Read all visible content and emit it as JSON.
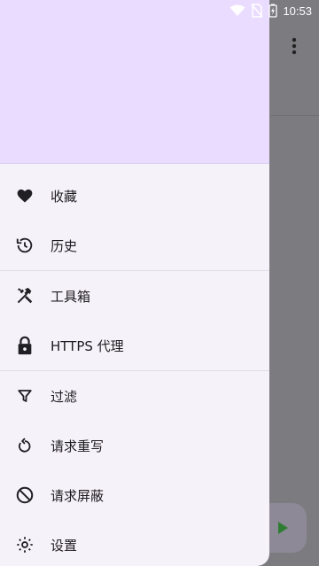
{
  "status_bar": {
    "time": "10:53",
    "icons": [
      "wifi-icon",
      "no-sim-icon",
      "battery-charging-icon"
    ]
  },
  "background": {
    "more_icon": "more-vert-icon",
    "fab_icon": "play-icon"
  },
  "drawer": {
    "groups": [
      [
        {
          "id": "favorites",
          "icon": "heart-icon",
          "label": "收藏"
        },
        {
          "id": "history",
          "icon": "history-icon",
          "label": "历史"
        }
      ],
      [
        {
          "id": "toolbox",
          "icon": "tools-icon",
          "label": "工具箱"
        },
        {
          "id": "https-proxy",
          "icon": "lock-icon",
          "label": "HTTPS 代理"
        }
      ],
      [
        {
          "id": "filter",
          "icon": "filter-icon",
          "label": "过滤"
        },
        {
          "id": "request-rewrite",
          "icon": "rewrite-icon",
          "label": "请求重写"
        },
        {
          "id": "request-block",
          "icon": "block-icon",
          "label": "请求屏蔽"
        },
        {
          "id": "settings",
          "icon": "settings-icon",
          "label": "设置"
        }
      ]
    ]
  }
}
